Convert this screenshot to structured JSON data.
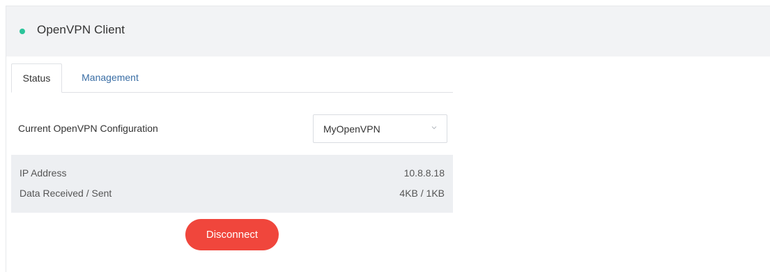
{
  "header": {
    "title": "OpenVPN Client",
    "status_color": "#2bc49a"
  },
  "tabs": [
    {
      "label": "Status",
      "active": true
    },
    {
      "label": "Management",
      "active": false
    }
  ],
  "config": {
    "label": "Current OpenVPN Configuration",
    "selected": "MyOpenVPN"
  },
  "info": {
    "ip_label": "IP Address",
    "ip_value": "10.8.8.18",
    "data_label": "Data Received / Sent",
    "data_value": "4KB / 1KB"
  },
  "actions": {
    "disconnect_label": "Disconnect",
    "disconnect_color": "#f0463c"
  }
}
